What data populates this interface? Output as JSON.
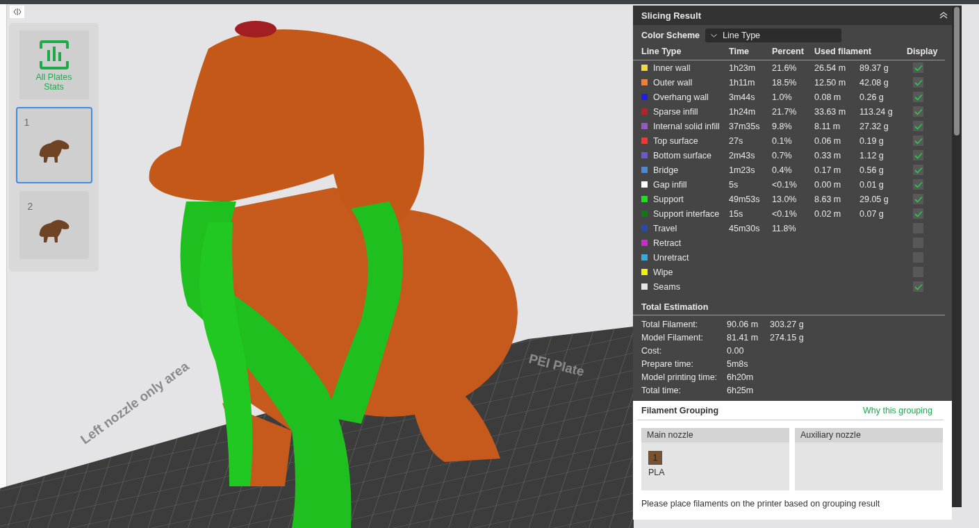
{
  "plates_sidebar": {
    "stats_button": "All Plates Stats",
    "plates": [
      {
        "label": "1",
        "selected": true
      },
      {
        "label": "2",
        "selected": false
      }
    ]
  },
  "viewport": {
    "bed_labels": [
      "Left nozzle only area",
      "PEI Plate"
    ]
  },
  "slicing_result": {
    "title": "Slicing Result",
    "color_scheme": {
      "label": "Color Scheme",
      "value": "Line Type"
    },
    "columns": [
      "Line Type",
      "Time",
      "Percent",
      "Used filament",
      "Display"
    ],
    "rows": [
      {
        "name": "Inner wall",
        "color": "#f5d63d",
        "time": "1h23m",
        "percent": "21.6%",
        "length": "26.54 m",
        "weight": "89.37 g",
        "checked": true
      },
      {
        "name": "Outer wall",
        "color": "#f07f38",
        "time": "1h11m",
        "percent": "18.5%",
        "length": "12.50 m",
        "weight": "42.08 g",
        "checked": true
      },
      {
        "name": "Overhang wall",
        "color": "#1d1df0",
        "time": "3m44s",
        "percent": "1.0%",
        "length": "0.08 m",
        "weight": "0.26 g",
        "checked": true
      },
      {
        "name": "Sparse infill",
        "color": "#b0242a",
        "time": "1h24m",
        "percent": "21.7%",
        "length": "33.63 m",
        "weight": "113.24 g",
        "checked": true
      },
      {
        "name": "Internal solid infill",
        "color": "#9a55c8",
        "time": "37m35s",
        "percent": "9.8%",
        "length": "8.11 m",
        "weight": "27.32 g",
        "checked": true
      },
      {
        "name": "Top surface",
        "color": "#f03a3a",
        "time": "27s",
        "percent": "0.1%",
        "length": "0.06 m",
        "weight": "0.19 g",
        "checked": true
      },
      {
        "name": "Bottom surface",
        "color": "#6a5ad0",
        "time": "2m43s",
        "percent": "0.7%",
        "length": "0.33 m",
        "weight": "1.12 g",
        "checked": true
      },
      {
        "name": "Bridge",
        "color": "#4f87d0",
        "time": "1m23s",
        "percent": "0.4%",
        "length": "0.17 m",
        "weight": "0.56 g",
        "checked": true
      },
      {
        "name": "Gap infill",
        "color": "#ffffff",
        "time": "5s",
        "percent": "<0.1%",
        "length": "0.00 m",
        "weight": "0.01 g",
        "checked": true
      },
      {
        "name": "Support",
        "color": "#1ee01e",
        "time": "49m53s",
        "percent": "13.0%",
        "length": "8.63 m",
        "weight": "29.05 g",
        "checked": true
      },
      {
        "name": "Support interface",
        "color": "#0e7a10",
        "time": "15s",
        "percent": "<0.1%",
        "length": "0.02 m",
        "weight": "0.07 g",
        "checked": true
      },
      {
        "name": "Travel",
        "color": "#2a4aa8",
        "time": "45m30s",
        "percent": "11.8%",
        "checked": false
      },
      {
        "name": "Retract",
        "color": "#d426d4",
        "checked": false
      },
      {
        "name": "Unretract",
        "color": "#3aaad8",
        "checked": false
      },
      {
        "name": "Wipe",
        "color": "#f5f000",
        "checked": false
      },
      {
        "name": "Seams",
        "color": "#e6e6e6",
        "checked": true
      }
    ],
    "total_estimation": {
      "title": "Total Estimation",
      "items": [
        {
          "label": "Total Filament:",
          "values": [
            "90.06 m",
            "303.27 g"
          ]
        },
        {
          "label": "Model Filament:",
          "values": [
            "81.41 m",
            "274.15 g"
          ]
        },
        {
          "label": "Cost:",
          "values": [
            "0.00"
          ]
        },
        {
          "label": "Prepare time:",
          "values": [
            "5m8s"
          ]
        },
        {
          "label": "Model printing time:",
          "values": [
            "6h20m"
          ]
        },
        {
          "label": "Total time:",
          "values": [
            "6h25m"
          ]
        }
      ]
    }
  },
  "filament_grouping": {
    "title": "Filament Grouping",
    "link": "Why this grouping",
    "nozzles": [
      {
        "name": "Main nozzle",
        "filaments": [
          {
            "slot": "1",
            "material": "PLA",
            "color": "#7a5230"
          }
        ]
      },
      {
        "name": "Auxiliary nozzle"
      }
    ],
    "note": "Please place filaments on the printer based on grouping result"
  }
}
